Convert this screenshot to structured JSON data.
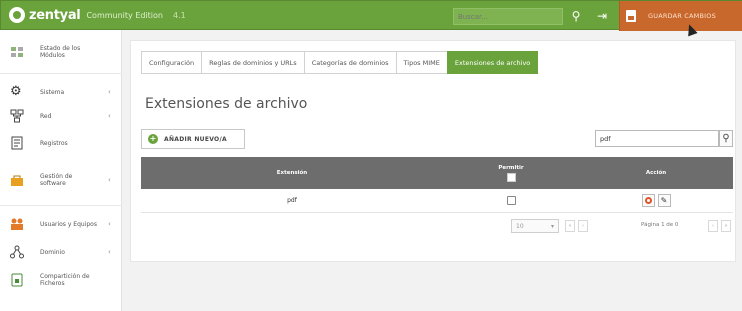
{
  "header": {
    "logo_text": "zentyal",
    "edition": "Community Edition",
    "version": "4.1",
    "search_placeholder": "Buscar...",
    "save_changes_label": "GUARDAR CAMBIOS"
  },
  "sidebar": {
    "items": [
      {
        "label": "Estado de los Módulos",
        "icon": "modules-icon",
        "arrow": ""
      },
      {
        "label": "Sistema",
        "icon": "gear-icon",
        "arrow": "‹"
      },
      {
        "label": "Red",
        "icon": "network-icon",
        "arrow": "‹"
      },
      {
        "label": "Registros",
        "icon": "logs-icon",
        "arrow": ""
      },
      {
        "label": "Gestión de software",
        "icon": "software-icon",
        "arrow": "‹"
      },
      {
        "label": "Usuarios y Equipos",
        "icon": "users-icon",
        "arrow": "‹"
      },
      {
        "label": "Dominio",
        "icon": "domain-icon",
        "arrow": "‹"
      },
      {
        "label": "Compartición de Ficheros",
        "icon": "file-sharing-icon",
        "arrow": ""
      }
    ]
  },
  "tabs": [
    {
      "label": "Configuración"
    },
    {
      "label": "Reglas de dominios y URLs"
    },
    {
      "label": "Categorías de dominios"
    },
    {
      "label": "Tipos MIME"
    },
    {
      "label": "Extensiones de archivo",
      "active": true
    }
  ],
  "page": {
    "title": "Extensiones de archivo",
    "add_button": "AÑADIR NUEVO/A",
    "filter_value": "pdf"
  },
  "table": {
    "columns": {
      "extension": "Extensión",
      "allow": "Permitir",
      "action": "Acción"
    },
    "rows": [
      {
        "extension": "pdf",
        "allowed": false
      }
    ]
  },
  "pager": {
    "page_size": "10",
    "page_info": "Página 1 de 0"
  },
  "colors": {
    "brand_green": "#6aa33c",
    "save_orange": "#c8682c",
    "table_header": "#6d6d6d"
  }
}
